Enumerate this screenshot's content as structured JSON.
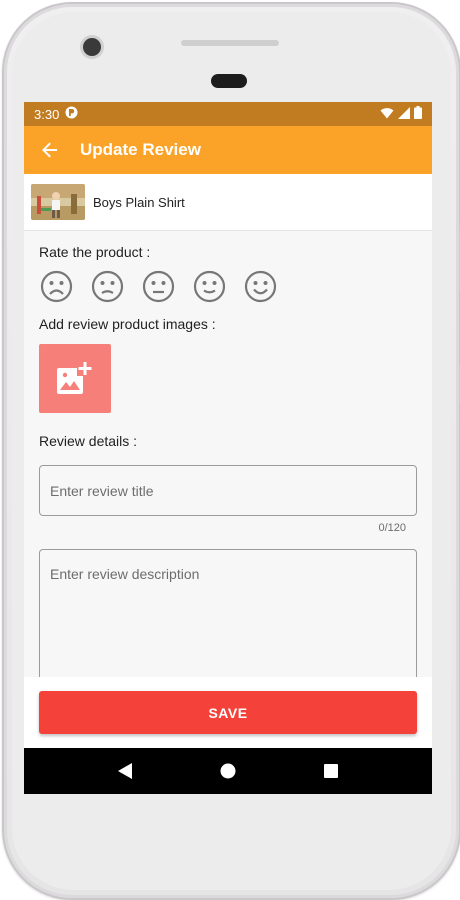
{
  "status_bar": {
    "time": "3:30"
  },
  "app_bar": {
    "title": "Update Review",
    "back_icon": "arrow-back-icon"
  },
  "product": {
    "name": "Boys Plain Shirt"
  },
  "rating": {
    "label": "Rate the product :",
    "faces": [
      "very-sad-face-icon",
      "sad-face-icon",
      "neutral-face-icon",
      "happy-face-icon",
      "very-happy-face-icon"
    ]
  },
  "images": {
    "label": "Add review product images :",
    "add_icon": "add-photo-icon"
  },
  "details": {
    "label": "Review details :",
    "title_placeholder": "Enter review title",
    "title_counter": "0/120",
    "description_placeholder": "Enter review description"
  },
  "actions": {
    "save_label": "SAVE"
  },
  "colors": {
    "status_bar": "#c17c22",
    "app_bar": "#fba328",
    "add_image_tile": "#f77f7a",
    "save_button": "#f4423b"
  }
}
